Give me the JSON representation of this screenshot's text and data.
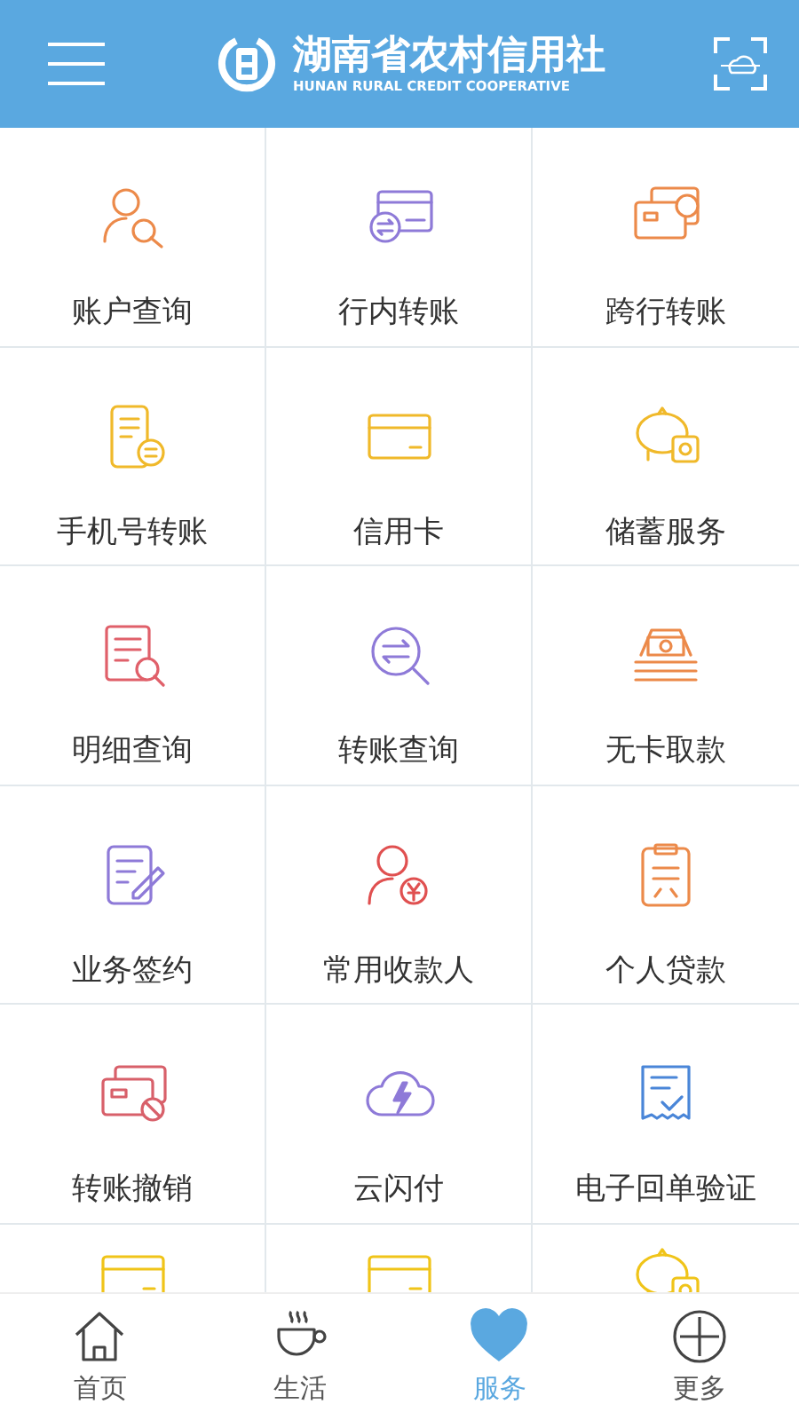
{
  "header": {
    "title": "湖南省农村信用社",
    "subtitle": "HUNAN RURAL CREDIT COOPERATIVE"
  },
  "services": [
    {
      "label": "账户查询",
      "kind": "person-search",
      "color": "#ec8a4a"
    },
    {
      "label": "行内转账",
      "kind": "card-transfer",
      "color": "#8e7ad8"
    },
    {
      "label": "跨行转账",
      "kind": "cards-transfer",
      "color": "#ec8a4a"
    },
    {
      "label": "手机号转账",
      "kind": "phone-transfer",
      "color": "#f0b92a"
    },
    {
      "label": "信用卡",
      "kind": "card",
      "color": "#f0b92a"
    },
    {
      "label": "储蓄服务",
      "kind": "piggy",
      "color": "#f0b92a"
    },
    {
      "label": "明细查询",
      "kind": "doc-search",
      "color": "#e0606a"
    },
    {
      "label": "转账查询",
      "kind": "search-transfer",
      "color": "#8e7ad8"
    },
    {
      "label": "无卡取款",
      "kind": "cash",
      "color": "#ec8a4a"
    },
    {
      "label": "业务签约",
      "kind": "doc-edit",
      "color": "#8e7ad8"
    },
    {
      "label": "常用收款人",
      "kind": "person-yen",
      "color": "#e05050"
    },
    {
      "label": "个人贷款",
      "kind": "clipboard",
      "color": "#ec8a4a"
    },
    {
      "label": "转账撤销",
      "kind": "card-cancel",
      "color": "#d8606a"
    },
    {
      "label": "云闪付",
      "kind": "cloud-bolt",
      "color": "#8e7ad8"
    },
    {
      "label": "电子回单验证",
      "kind": "receipt-check",
      "color": "#4a86d8"
    }
  ],
  "partial_row": [
    {
      "kind": "card",
      "color": "#f0c419"
    },
    {
      "kind": "card",
      "color": "#f0c419"
    },
    {
      "kind": "piggy",
      "color": "#f0c419"
    }
  ],
  "tabs": [
    {
      "label": "首页",
      "kind": "home",
      "selected": false
    },
    {
      "label": "生活",
      "kind": "cup",
      "selected": false
    },
    {
      "label": "服务",
      "kind": "heart",
      "selected": true
    },
    {
      "label": "更多",
      "kind": "plus",
      "selected": false
    }
  ]
}
